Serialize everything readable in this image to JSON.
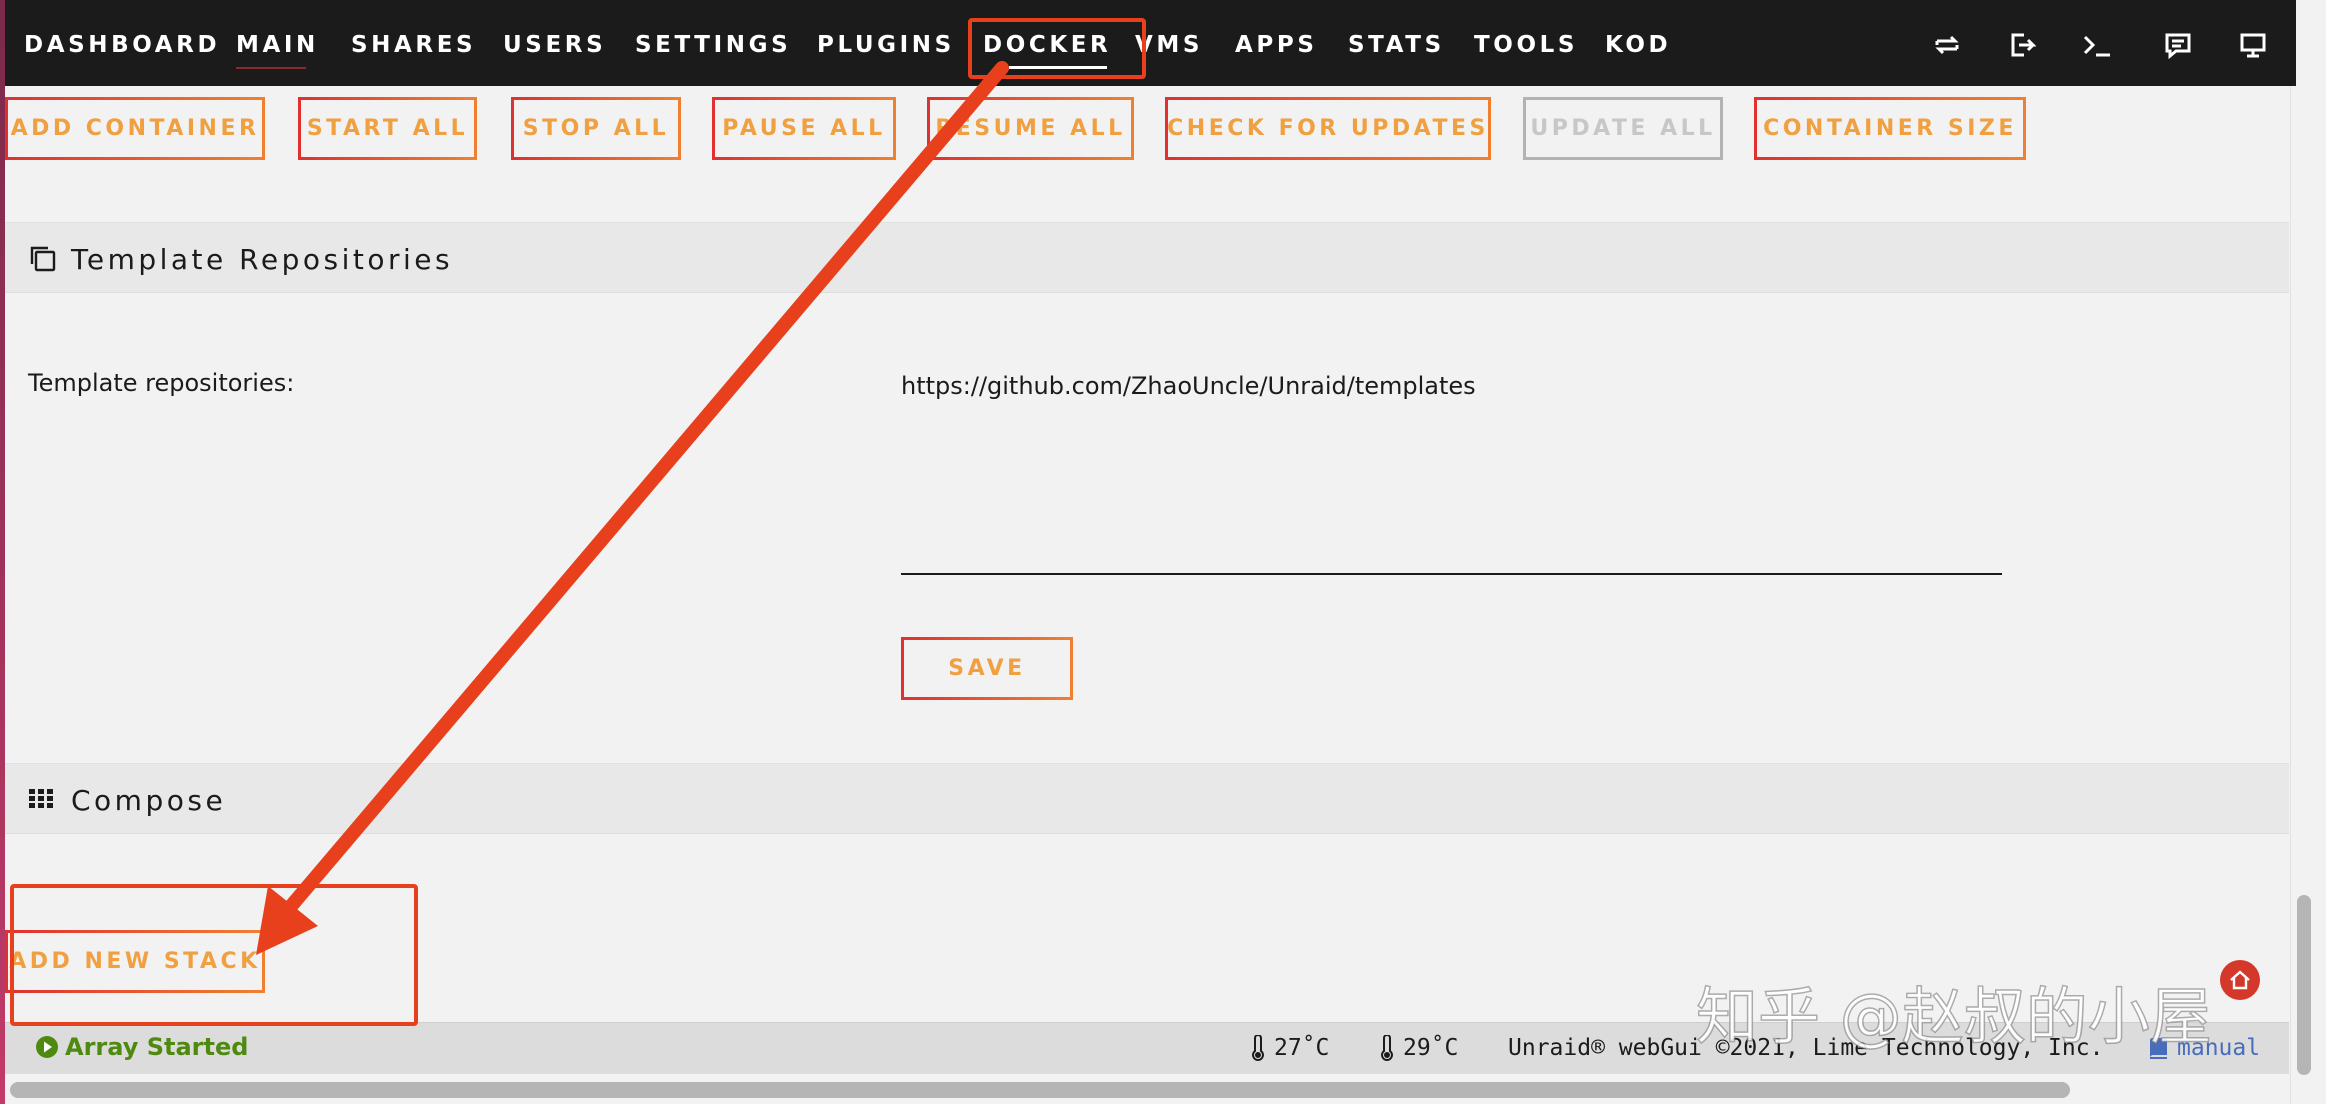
{
  "nav": {
    "items": [
      "DASHBOARD",
      "MAIN",
      "SHARES",
      "USERS",
      "SETTINGS",
      "PLUGINS",
      "DOCKER",
      "VMS",
      "APPS",
      "STATS",
      "TOOLS",
      "KOD"
    ],
    "active": "DOCKER",
    "right_icons": [
      "switch-icon",
      "logout-icon",
      "terminal-icon",
      "feedback-icon",
      "monitor-icon"
    ]
  },
  "toolbar": {
    "add_container": "ADD CONTAINER",
    "start_all": "START ALL",
    "stop_all": "STOP ALL",
    "pause_all": "PAUSE ALL",
    "resume_all": "RESUME ALL",
    "check_updates": "CHECK FOR UPDATES",
    "update_all": "UPDATE ALL",
    "container_size": "CONTAINER SIZE"
  },
  "template_section": {
    "title": "Template Repositories",
    "label": "Template repositories:",
    "value": "https://github.com/ZhaoUncle/Unraid/templates",
    "save": "SAVE"
  },
  "compose_section": {
    "title": "Compose",
    "add_stack": "ADD NEW STACK"
  },
  "status": {
    "array": "Array Started",
    "temp1": "27˚C",
    "temp2": "29˚C",
    "copyright": "Unraid® webGui ©2021, Lime Technology, Inc.",
    "manual": "manual"
  },
  "watermark": "知乎 @赵叔的小屋",
  "colors": {
    "accent_red": "#e03030",
    "accent_orange": "#f08030",
    "annotation": "#e8401c",
    "status_green": "#4f8a10",
    "nav_bg": "#1c1b1b"
  }
}
